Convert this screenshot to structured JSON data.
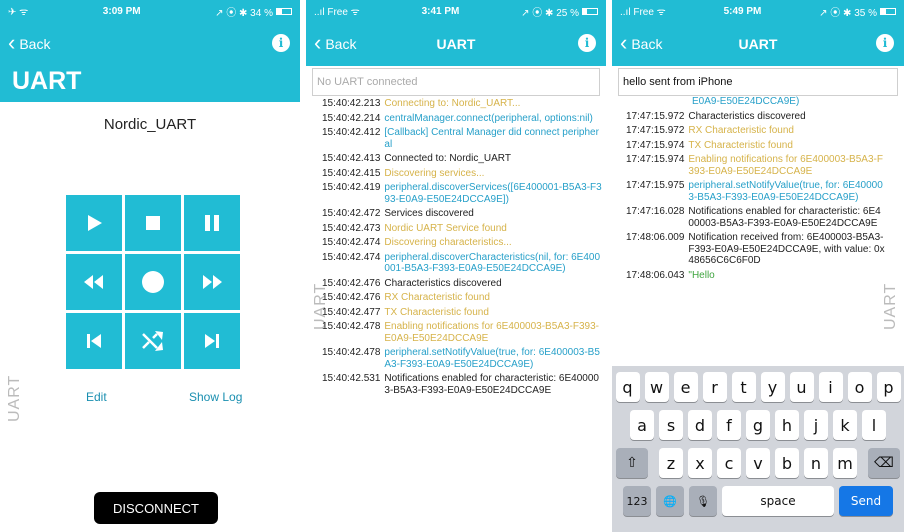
{
  "panel1": {
    "status": {
      "left": "✈ ᯤ",
      "time": "3:09 PM",
      "right": "↗ ⦿ ✱ 34 %"
    },
    "nav": {
      "back": "Back",
      "info": "i"
    },
    "title": "UART",
    "device_name": "Nordic_UART",
    "side_label": "UART",
    "controls": [
      "play-icon",
      "stop-icon",
      "pause-icon",
      "rewind-icon",
      "record-icon",
      "fast-forward-icon",
      "skip-back-icon",
      "shuffle-icon",
      "skip-forward-icon"
    ],
    "edit": "Edit",
    "show_log": "Show Log",
    "disconnect": "DISCONNECT",
    "battery_level": 34
  },
  "panel2": {
    "status": {
      "left": "..ıl Free ᯤ",
      "time": "3:41 PM",
      "right": "↗ ⦿ ✱ 25 %"
    },
    "nav": {
      "back": "Back",
      "title": "UART",
      "info": "i"
    },
    "input_placeholder": "No UART connected",
    "side_label": "UART",
    "battery_level": 25,
    "logs": [
      {
        "t": "15:40:42.213",
        "m": "Connecting to: Nordic_UART...",
        "c": "yellow"
      },
      {
        "t": "15:40:42.214",
        "m": "centralManager.connect(peripheral, options:nil)",
        "c": "blue"
      },
      {
        "t": "15:40:42.412",
        "m": "[Callback] Central Manager did connect peripheral",
        "c": "blue"
      },
      {
        "t": "15:40:42.413",
        "m": "Connected to: Nordic_UART",
        "c": "black"
      },
      {
        "t": "15:40:42.415",
        "m": "Discovering services...",
        "c": "yellow"
      },
      {
        "t": "15:40:42.419",
        "m": "peripheral.discoverServices([6E400001-B5A3-F393-E0A9-E50E24DCCA9E])",
        "c": "blue"
      },
      {
        "t": "15:40:42.472",
        "m": "Services discovered",
        "c": "black"
      },
      {
        "t": "15:40:42.473",
        "m": "Nordic UART Service found",
        "c": "yellow"
      },
      {
        "t": "15:40:42.474",
        "m": "Discovering characteristics...",
        "c": "yellow"
      },
      {
        "t": "15:40:42.474",
        "m": "peripheral.discoverCharacteristics(nil, for: 6E400001-B5A3-F393-E0A9-E50E24DCCA9E)",
        "c": "blue"
      },
      {
        "t": "15:40:42.476",
        "m": "Characteristics discovered",
        "c": "black"
      },
      {
        "t": "15:40:42.476",
        "m": "RX Characteristic found",
        "c": "yellow"
      },
      {
        "t": "15:40:42.477",
        "m": "TX Characteristic found",
        "c": "yellow"
      },
      {
        "t": "15:40:42.478",
        "m": "Enabling notifications for 6E400003-B5A3-F393-E0A9-E50E24DCCA9E",
        "c": "yellow"
      },
      {
        "t": "15:40:42.478",
        "m": "peripheral.setNotifyValue(true, for: 6E400003-B5A3-F393-E0A9-E50E24DCCA9E)",
        "c": "blue"
      },
      {
        "t": "15:40:42.531",
        "m": "Notifications enabled for characteristic: 6E400003-B5A3-F393-E0A9-E50E24DCCA9E",
        "c": "black"
      }
    ]
  },
  "panel3": {
    "status": {
      "left": "..ıl Free ᯤ",
      "time": "5:49 PM",
      "right": "↗ ⦿ ✱ 35 %"
    },
    "nav": {
      "back": "Back",
      "title": "UART",
      "info": "i"
    },
    "input_value": "hello sent from iPhone",
    "side_label": "UART",
    "battery_level": 35,
    "logs": [
      {
        "t": "",
        "m": "E0A9-E50E24DCCA9E)",
        "c": "blue"
      },
      {
        "t": "17:47:15.972",
        "m": "Characteristics discovered",
        "c": "black"
      },
      {
        "t": "17:47:15.972",
        "m": "RX Characteristic found",
        "c": "yellow"
      },
      {
        "t": "17:47:15.974",
        "m": "TX Characteristic found",
        "c": "yellow"
      },
      {
        "t": "17:47:15.974",
        "m": "Enabling notifications for 6E400003-B5A3-F393-E0A9-E50E24DCCA9E",
        "c": "yellow"
      },
      {
        "t": "17:47:15.975",
        "m": "peripheral.setNotifyValue(true, for: 6E400003-B5A3-F393-E0A9-E50E24DCCA9E)",
        "c": "blue"
      },
      {
        "t": "17:47:16.028",
        "m": "Notifications enabled for characteristic: 6E400003-B5A3-F393-E0A9-E50E24DCCA9E",
        "c": "black"
      },
      {
        "t": "17:48:06.009",
        "m": "Notification received from: 6E400003-B5A3-F393-E0A9-E50E24DCCA9E, with value: 0x48656C6C6F0D",
        "c": "black"
      },
      {
        "t": "17:48:06.043",
        "m": "\"Hello",
        "c": "green"
      }
    ],
    "keyboard": {
      "row1": [
        "q",
        "w",
        "e",
        "r",
        "t",
        "y",
        "u",
        "i",
        "o",
        "p"
      ],
      "row2": [
        "a",
        "s",
        "d",
        "f",
        "g",
        "h",
        "j",
        "k",
        "l"
      ],
      "row3": [
        "z",
        "x",
        "c",
        "v",
        "b",
        "n",
        "m"
      ],
      "shift": "⇧",
      "backspace": "⌫",
      "numbers": "123",
      "globe": "🌐",
      "mic": "🎙",
      "space": "space",
      "send": "Send"
    }
  },
  "colors": {
    "accent": "#21bcd4",
    "log_yellow": "#d6b34a",
    "log_blue": "#27a0c9",
    "log_green": "#3fa43f"
  }
}
